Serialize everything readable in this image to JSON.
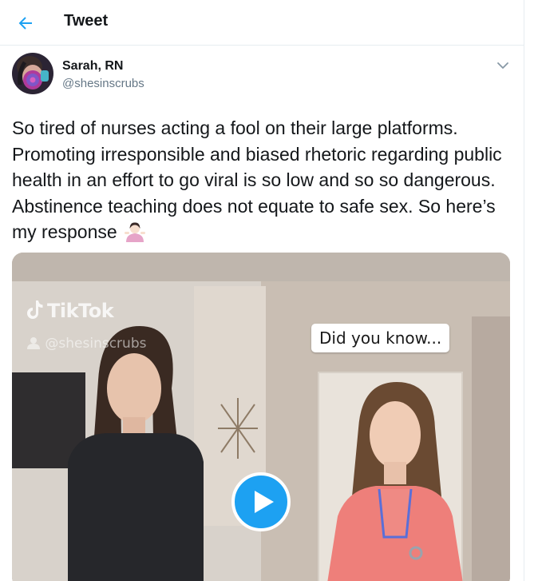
{
  "header": {
    "title": "Tweet",
    "back_icon": "arrow-left-icon"
  },
  "author": {
    "name": "Sarah, RN",
    "handle": "@shesinscrubs",
    "avatar_icon": "avatar-image"
  },
  "menu": {
    "icon": "chevron-down-icon"
  },
  "tweet": {
    "text": "So tired of nurses acting a fool on their large platforms. Promoting irresponsible and biased rhetoric regarding public health in an effort to go viral is so low and so so dangerous. Abstinence teaching does not equate to safe sex. So here’s my response",
    "emoji": "person-shrugging-emoji"
  },
  "media": {
    "watermark_brand": "TikTok",
    "watermark_user": "@shesinscrubs",
    "caption": "Did you know...",
    "play_icon": "play-icon"
  },
  "colors": {
    "accent": "#1da1f2",
    "text": "#14171a",
    "secondary": "#657786",
    "border": "#e6ecf0"
  }
}
